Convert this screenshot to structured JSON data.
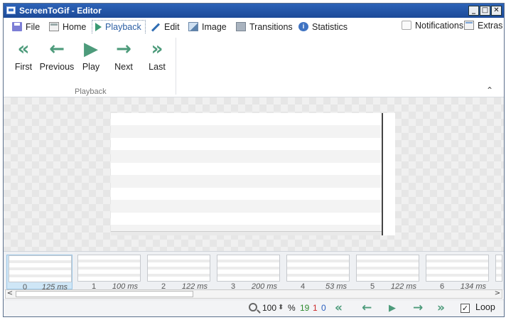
{
  "window": {
    "title": "ScreenToGif - Editor",
    "min_glyph": "_",
    "max_glyph": "□",
    "close_glyph": "✕"
  },
  "tabs": [
    {
      "label": "File",
      "icon": "floppy-icon"
    },
    {
      "label": "Home",
      "icon": "home-icon"
    },
    {
      "label": "Playback",
      "icon": "play-icon",
      "active": true
    },
    {
      "label": "Edit",
      "icon": "pencil-icon"
    },
    {
      "label": "Image",
      "icon": "image-icon"
    },
    {
      "label": "Transitions",
      "icon": "transitions-icon"
    },
    {
      "label": "Statistics",
      "icon": "info-icon"
    }
  ],
  "right_tabs": {
    "notifications": "Notifications",
    "extras": "Extras"
  },
  "ribbon": {
    "buttons": [
      {
        "label": "First",
        "glyph": "«"
      },
      {
        "label": "Previous",
        "glyph": "←"
      },
      {
        "label": "Play",
        "glyph": "▶"
      },
      {
        "label": "Next",
        "glyph": "→"
      },
      {
        "label": "Last",
        "glyph": "»"
      }
    ],
    "group_label": "Playback",
    "collapse_glyph": "⌃"
  },
  "frames": [
    {
      "index": "0",
      "delay": "125 ms",
      "selected": true
    },
    {
      "index": "1",
      "delay": "100 ms"
    },
    {
      "index": "2",
      "delay": "122 ms"
    },
    {
      "index": "3",
      "delay": "200 ms"
    },
    {
      "index": "4",
      "delay": "53 ms"
    },
    {
      "index": "5",
      "delay": "122 ms"
    },
    {
      "index": "6",
      "delay": "134 ms"
    }
  ],
  "status": {
    "zoom": "100",
    "zoom_unit": "%",
    "spin_glyph": "⬍",
    "frame_count": "19",
    "selected_count": "1",
    "current_frame": "0",
    "colors": {
      "frame_count": "#2e8b2e",
      "selected_count": "#cc2a2a",
      "current_frame": "#2a5fbf"
    },
    "nav": [
      "«",
      "←",
      "▶",
      "→",
      "»"
    ],
    "loop_label": "Loop",
    "loop_checked": true,
    "check_glyph": "✓"
  },
  "scroll": {
    "left_glyph": "<",
    "right_glyph": ">"
  }
}
